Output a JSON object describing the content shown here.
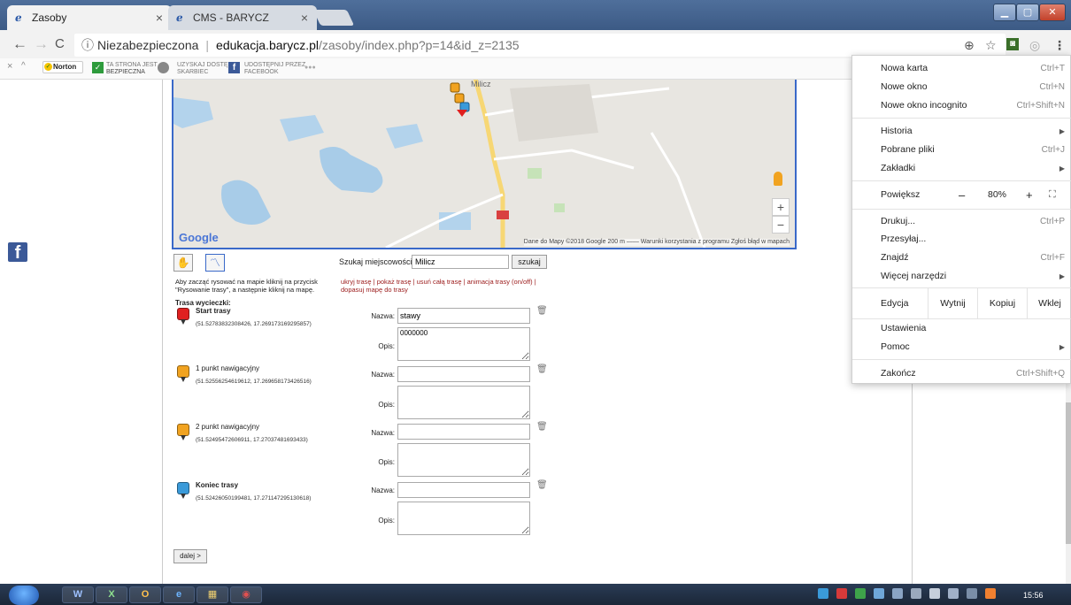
{
  "browser": {
    "tabs": [
      {
        "title": "Zasoby",
        "active": true
      },
      {
        "title": "CMS - BARYCZ",
        "active": false
      }
    ],
    "url": {
      "security": "Niezabezpieczona",
      "host": "edukacja.barycz.pl",
      "path": "/zasoby/index.php?p=14&id_z=2135"
    },
    "extensions": {
      "norton": "Norton",
      "safe_line1": "TA STRONA JEST",
      "safe_line2": "BEZPIECZNA",
      "vault_line1": "UZYSKAJ DOSTĘP",
      "vault_line2": "SKARBIEC",
      "fb_line1": "UDOSTĘPNIJ PRZEZ",
      "fb_line2": "FACEBOOK",
      "more": "●●●"
    }
  },
  "menu": {
    "items_top": [
      {
        "label": "Nowa karta",
        "shortcut": "Ctrl+T"
      },
      {
        "label": "Nowe okno",
        "shortcut": "Ctrl+N"
      },
      {
        "label": "Nowe okno incognito",
        "shortcut": "Ctrl+Shift+N"
      }
    ],
    "items_mid": [
      {
        "label": "Historia",
        "shortcut": ""
      },
      {
        "label": "Pobrane pliki",
        "shortcut": "Ctrl+J"
      },
      {
        "label": "Zakładki",
        "shortcut": ""
      }
    ],
    "zoom": {
      "label": "Powiększ",
      "minus": "–",
      "value": "80%",
      "plus": "+"
    },
    "items_tools": [
      {
        "label": "Drukuj...",
        "shortcut": "Ctrl+P"
      },
      {
        "label": "Przesyłaj...",
        "shortcut": ""
      },
      {
        "label": "Znajdź",
        "shortcut": "Ctrl+F"
      },
      {
        "label": "Więcej narzędzi",
        "shortcut": ""
      }
    ],
    "edit": {
      "label": "Edycja",
      "cut": "Wytnij",
      "copy": "Kopiuj",
      "paste": "Wklej"
    },
    "items_settings": [
      {
        "label": "Ustawienia",
        "shortcut": ""
      },
      {
        "label": "Pomoc",
        "shortcut": ""
      }
    ],
    "exit": {
      "label": "Zakończ",
      "shortcut": "Ctrl+Shift+Q"
    }
  },
  "map": {
    "logo": "Google",
    "attribution": "Dane do Mapy ©2018 Google   200 m ⎯⎯⎯⎯   Warunki korzystania z programu   Zgłoś błąd w mapach",
    "place_label": "Milicz",
    "zoom_in": "+",
    "zoom_out": "−"
  },
  "search": {
    "label": "Szukaj miejscowości:",
    "value": "Milicz",
    "button": "szukaj"
  },
  "hint": "Aby zacząć rysować na mapie kliknij na przycisk \"Rysowanie trasy\", a następnie kliknij na mapę.",
  "links": {
    "hide": "ukryj trasę",
    "show": "pokaż trasę",
    "delete": "usuń całą trasę",
    "animation": "animacja trasy (on/off)",
    "fit": "dopasuj mapę do trasy",
    "sep": " | "
  },
  "route": {
    "title": "Trasa wycieczki:",
    "name_label": "Nazwa:",
    "desc_label": "Opis:",
    "waypoints": [
      {
        "name": "Start trasy",
        "coords": "(51.52783832308426, 17.269173169295857)",
        "name_value": "stawy",
        "desc_value": "0000000",
        "color": "#e02020"
      },
      {
        "name": "1 punkt nawigacyjny",
        "coords": "(51.52556254619612, 17.269658173426516)",
        "name_value": "",
        "desc_value": "",
        "color": "#f1a320"
      },
      {
        "name": "2 punkt nawigacyjny",
        "coords": "(51.52495472606911, 17.27037481693433)",
        "name_value": "",
        "desc_value": "",
        "color": "#f1a320"
      },
      {
        "name": "Koniec trasy",
        "coords": "(51.52426050199481, 17.271147295130618)",
        "name_value": "",
        "desc_value": "",
        "color": "#3a9ad9"
      }
    ]
  },
  "next_button": "dalej >",
  "taskbar": {
    "apps": [
      "W",
      "X",
      "O",
      "e",
      "▦",
      "◉"
    ],
    "clock": "15:56"
  }
}
